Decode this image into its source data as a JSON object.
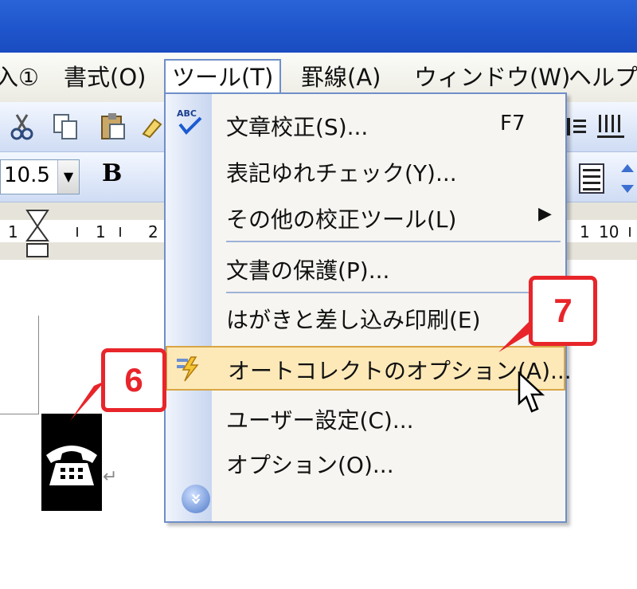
{
  "menubar": {
    "items": [
      {
        "label": "入①"
      },
      {
        "label": "書式(O)"
      },
      {
        "label": "ツール(T)"
      },
      {
        "label": "罫線(A)"
      },
      {
        "label": "ウィンドウ(W)"
      },
      {
        "label": "ヘルプ("
      }
    ]
  },
  "toolbar": {
    "font_size_value": "10.5",
    "bold_label": "B"
  },
  "ruler": {
    "labels": [
      "1",
      "1",
      "2",
      "1",
      "10"
    ]
  },
  "tools_menu": {
    "items": [
      {
        "label": "文章校正(S)...",
        "shortcut": "F7"
      },
      {
        "label": "表記ゆれチェック(Y)..."
      },
      {
        "label": "その他の校正ツール(L)",
        "submenu_arrow": "▶"
      },
      {
        "label": "文書の保護(P)..."
      },
      {
        "label": "はがきと差し込み印刷(E)"
      },
      {
        "label": "オートコレクトのオプション(A)...",
        "highlighted": true
      },
      {
        "label": "ユーザー設定(C)..."
      },
      {
        "label": "オプション(O)..."
      }
    ],
    "expand_glyph": "»"
  },
  "document": {
    "return_mark": "↵"
  },
  "callouts": [
    {
      "number": "6"
    },
    {
      "number": "7"
    }
  ],
  "colors": {
    "titlebar": "#1f55cc",
    "callout_red": "#e8252a",
    "highlight_fill": "#fde9b8",
    "menu_border": "#6f8fc9"
  }
}
